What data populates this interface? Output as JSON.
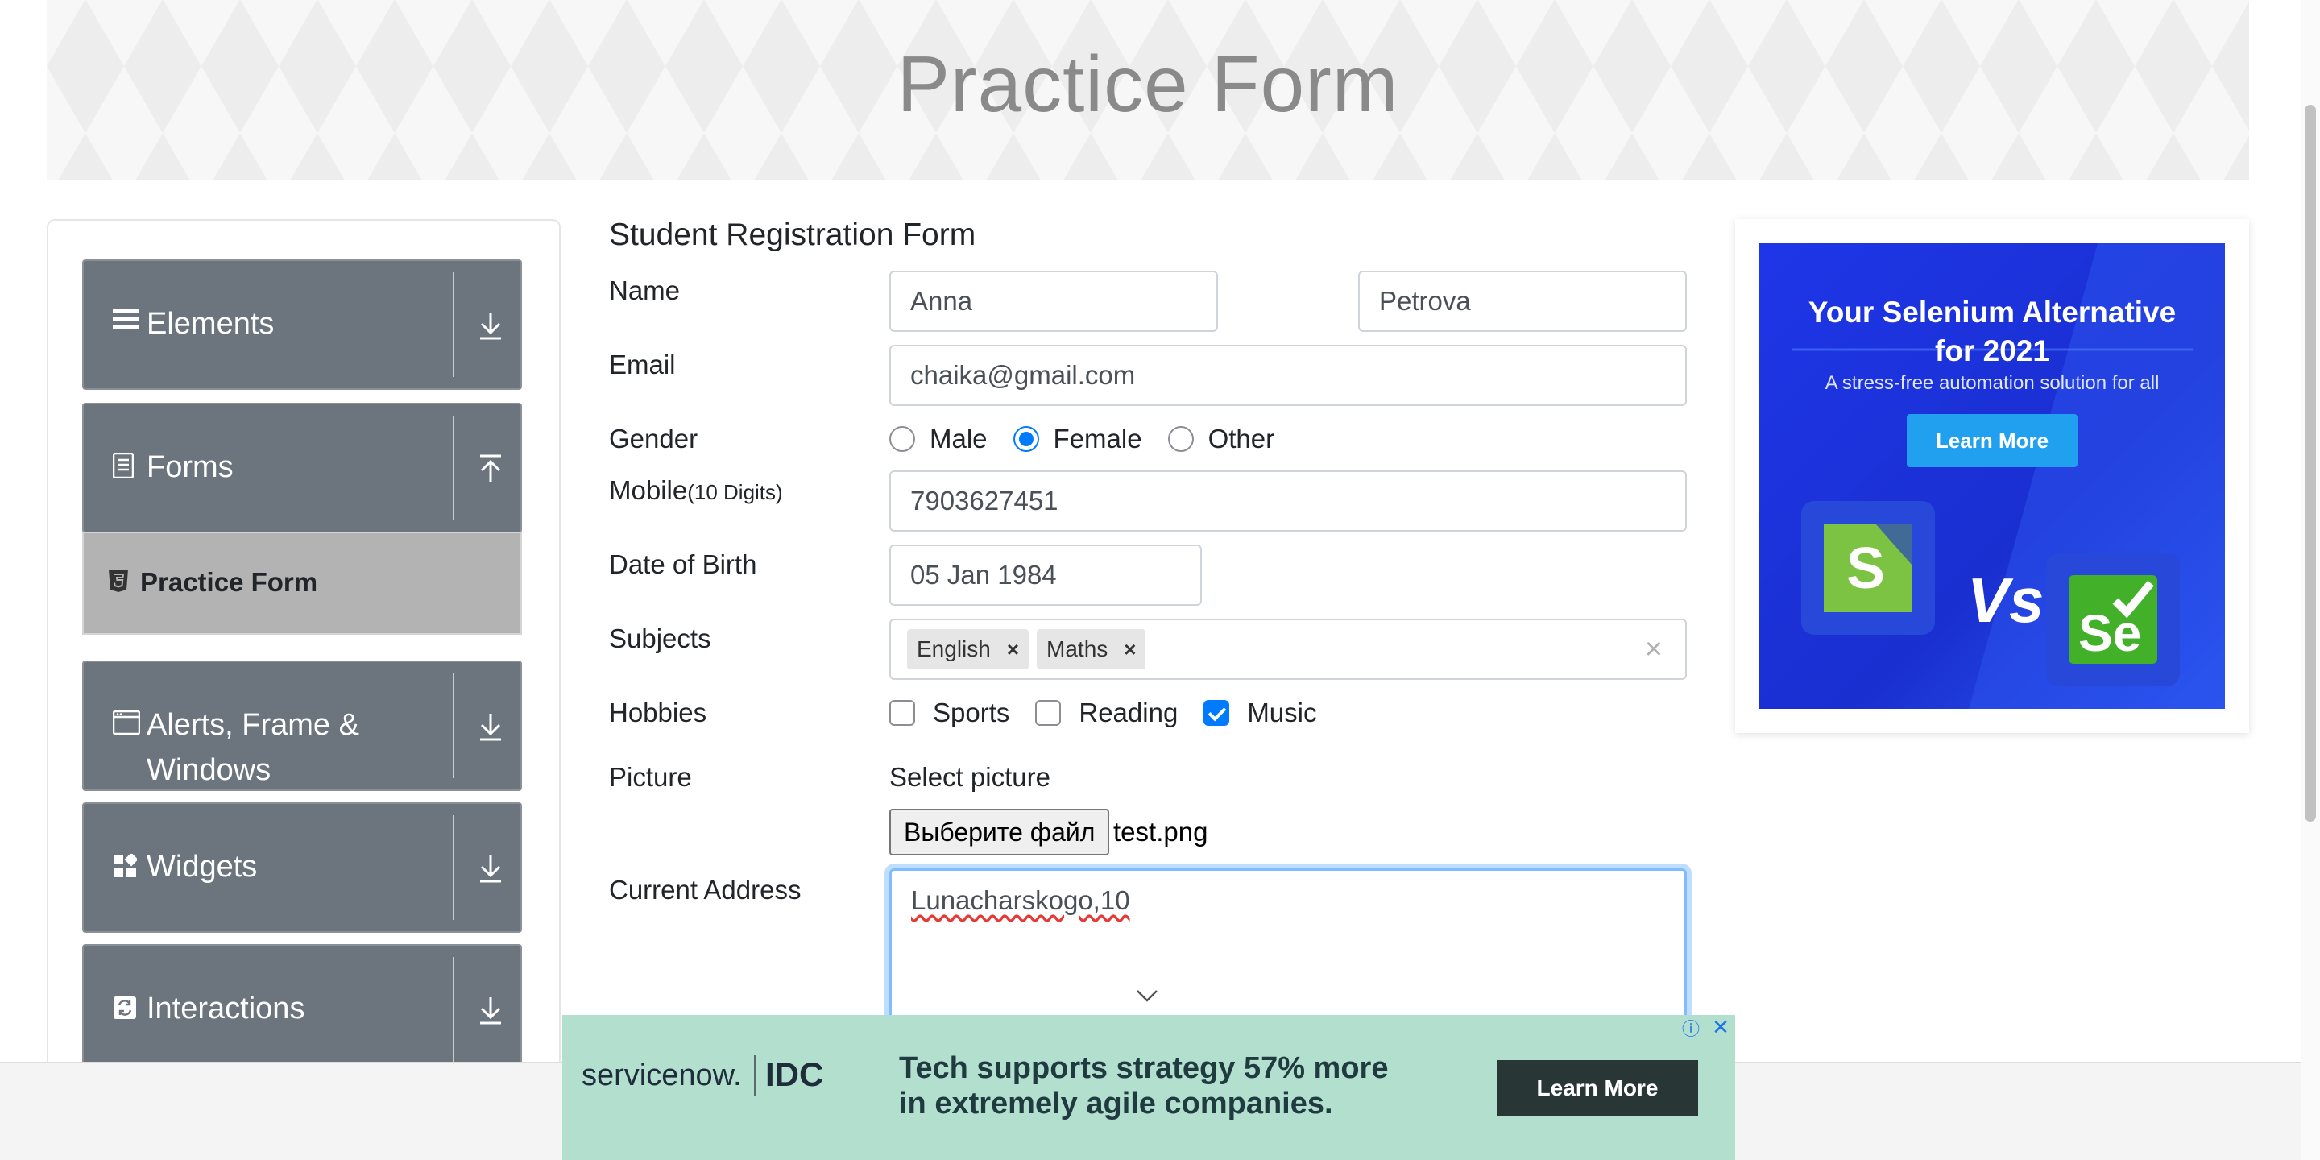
{
  "header": {
    "title": "Practice Form"
  },
  "sidebar": {
    "groups": [
      {
        "label": "Elements",
        "icon": "hamburger-icon",
        "arrow": "download-icon"
      },
      {
        "label": "Forms",
        "icon": "document-icon",
        "arrow": "upload-icon"
      },
      {
        "label": "Alerts, Frame & Windows",
        "label_line1": "Alerts, Frame &",
        "label_line2": "Windows",
        "icon": "window-icon",
        "arrow": "download-icon"
      },
      {
        "label": "Widgets",
        "icon": "widgets-icon",
        "arrow": "download-icon"
      },
      {
        "label": "Interactions",
        "icon": "interactions-icon",
        "arrow": "download-icon"
      }
    ],
    "active_item": {
      "label": "Practice Form",
      "icon": "html5-icon"
    }
  },
  "form": {
    "title": "Student Registration Form",
    "name_label": "Name",
    "first_name": "Anna",
    "last_name": "Petrova",
    "email_label": "Email",
    "email": "chaika@gmail.com",
    "gender_label": "Gender",
    "genders": [
      {
        "label": "Male",
        "checked": false
      },
      {
        "label": "Female",
        "checked": true
      },
      {
        "label": "Other",
        "checked": false
      }
    ],
    "mobile_label": "Mobile",
    "mobile_hint": "(10 Digits)",
    "mobile": "7903627451",
    "dob_label": "Date of Birth",
    "dob": "05 Jan 1984",
    "subjects_label": "Subjects",
    "subjects": [
      "English",
      "Maths"
    ],
    "tag_remove": "×",
    "subjects_clear": "×",
    "hobbies_label": "Hobbies",
    "hobbies": [
      {
        "label": "Sports",
        "checked": false
      },
      {
        "label": "Reading",
        "checked": false
      },
      {
        "label": "Music",
        "checked": true
      }
    ],
    "picture_label": "Picture",
    "select_picture": "Select picture",
    "file_button": "Выберите файл",
    "file_name": "test.png",
    "address_label": "Current Address",
    "address": "Lunacharskogo,10"
  },
  "ad_right": {
    "title_line1": "Your Selenium Alternative",
    "title_line2": "for 2021",
    "subtitle": "A stress-free automation solution for all",
    "button": "Learn More",
    "vs": "Vs"
  },
  "ad_bottom": {
    "brand1": "servicenow.",
    "brand2": "IDC",
    "text_line1": "Tech supports strategy 57% more",
    "text_line2": "in extremely agile companies.",
    "button": "Learn More",
    "info": "ⓘ",
    "close": "✕"
  },
  "colors": {
    "sidebar_bg": "#6c757d",
    "active_item_bg": "#b3b3b3",
    "accent": "#007bff",
    "ad_blue": "#1e36e8",
    "ad_green": "#b3dfcf"
  }
}
